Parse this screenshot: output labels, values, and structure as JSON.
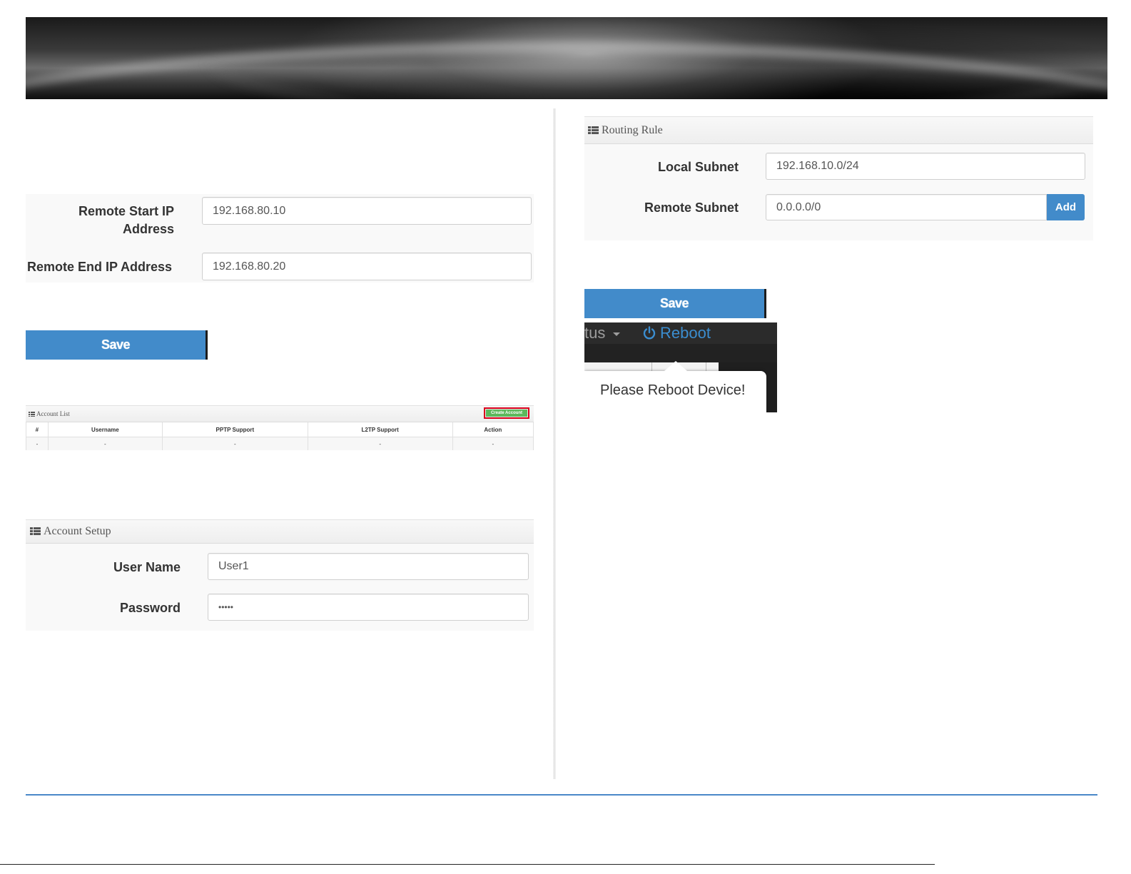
{
  "vpn_ip_range": {
    "remote_start_label": "Remote Start IP Address",
    "remote_start_value": "192.168.80.10",
    "remote_end_label": "Remote End IP Address",
    "remote_end_value": "192.168.80.20",
    "save_label": "Save"
  },
  "account_list": {
    "title": "Account List",
    "create_label": "Create Account",
    "columns": [
      "#",
      "Username",
      "PPTP Support",
      "L2TP Support",
      "Action"
    ],
    "row": [
      "-",
      "-",
      "-",
      "-",
      "-"
    ]
  },
  "account_setup": {
    "title": "Account Setup",
    "username_label": "User Name",
    "username_value": "User1",
    "password_label": "Password",
    "password_value": "•••••"
  },
  "routing_rule": {
    "title": "Routing Rule",
    "local_label": "Local Subnet",
    "local_value": "192.168.10.0/24",
    "remote_label": "Remote Subnet",
    "remote_value": "0.0.0.0/0",
    "add_label": "Add",
    "save_label": "Save"
  },
  "reboot_snippet": {
    "status_text": "tus",
    "reboot_label": "Reboot",
    "popover_text": "Please Reboot Device!"
  },
  "colors": {
    "primary": "#428bca",
    "success": "#5cb85c",
    "highlight": "#d9001b",
    "rule": "#4a88c8"
  }
}
